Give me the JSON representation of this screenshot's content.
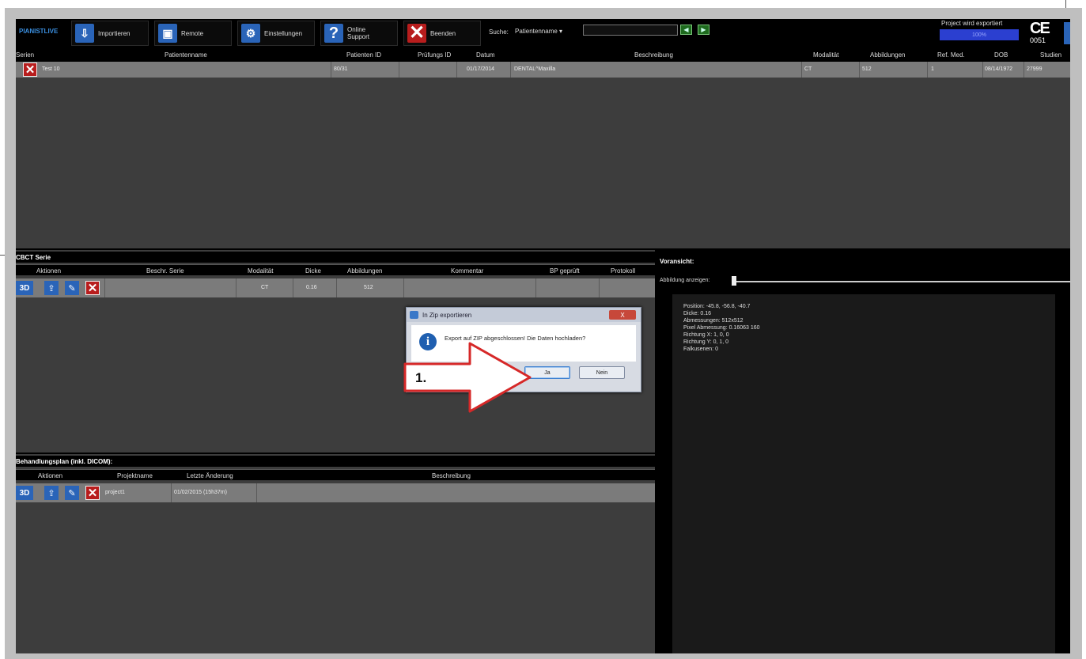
{
  "toolbar": {
    "brand": "PIANISTLIVE",
    "import_label": "Importieren",
    "remote_label": "Remote",
    "settings_label": "Einstellungen",
    "support_line1": "Online",
    "support_line2": "Support",
    "quit_label": "Beenden",
    "search_label": "Suche:",
    "search_field_select": "Patientenname",
    "search_value": "",
    "export_status": "Project wird exportiert",
    "export_progress_text": "100%",
    "export_progress": 1.0,
    "ce_mark": "CE",
    "ce_number": "0051"
  },
  "patients": {
    "headers": [
      "Serien",
      "Patientenname",
      "Patienten ID",
      "Prüfungs ID",
      "Datum",
      "Beschreibung",
      "Modalität",
      "Abbildungen",
      "Ref. Med.",
      "DOB",
      "Studien"
    ],
    "row": {
      "name": "Test 10",
      "patient_id": "80/31",
      "exam_id": "",
      "date": "01/17/2014",
      "description": "DENTAL^Maxilla",
      "modality": "CT",
      "images": "512",
      "ref_med": "1",
      "dob": "08/14/1972",
      "study": "27999"
    }
  },
  "series": {
    "title": "CBCT Serie",
    "headers": [
      "Aktionen",
      "Beschr. Serie",
      "Modalität",
      "Dicke",
      "Abbildungen",
      "Kommentar",
      "BP geprüft",
      "Protokoll"
    ],
    "row": {
      "desc": "",
      "modality": "CT",
      "thickness": "0.16",
      "images": "512",
      "comment": "",
      "bp_checked": "",
      "protocol": ""
    },
    "btn_3d": "3D"
  },
  "plan": {
    "title": "Behandlungsplan (inkl. DICOM):",
    "headers": [
      "Aktionen",
      "Projektname",
      "Letzte Änderung",
      "Beschreibung"
    ],
    "row": {
      "project": "project1",
      "last_change": "01/02/2015 (15h37m)",
      "description": ""
    },
    "btn_3d": "3D"
  },
  "preview": {
    "title": "Voransicht:",
    "show_image_label": "Abbildung anzeigen:",
    "info_lines": [
      "Position: -45.8, -56.8, -40.7",
      "Dicke: 0.16",
      "Abmessungen: 512x512",
      "Pixel Abmessung: 0.16063 160",
      "Richtung X: 1, 0, 0",
      "Richtung Y: 0, 1, 0",
      "Falkusenen: 0"
    ]
  },
  "dialog": {
    "title": "In Zip exportieren",
    "close": "X",
    "message": "Export auf ZIP abgeschlossen! Die Daten hochladen?",
    "yes": "Ja",
    "no": "Nein"
  },
  "annotation": {
    "step": "1."
  }
}
